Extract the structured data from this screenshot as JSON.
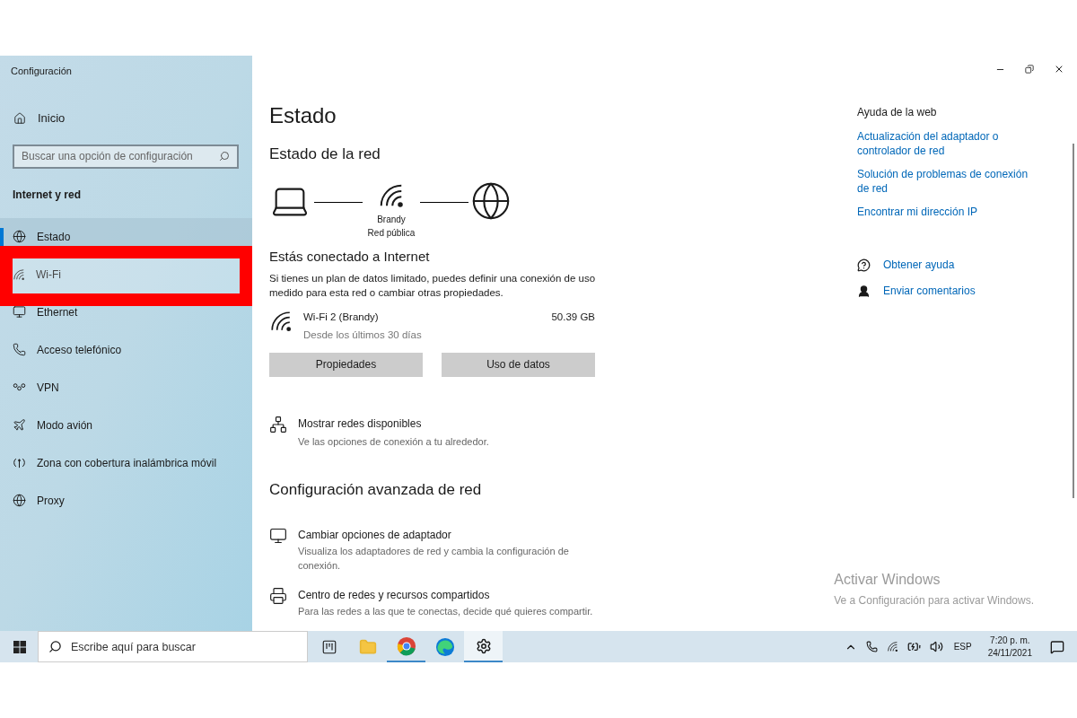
{
  "window": {
    "title": "Configuración"
  },
  "sidebar": {
    "home": "Inicio",
    "search": {
      "placeholder": "Buscar una opción de configuración"
    },
    "section": "Internet y red",
    "items": [
      {
        "label": "Estado",
        "selected": true,
        "highlighted": false
      },
      {
        "label": "Wi-Fi",
        "selected": false,
        "highlighted": true
      },
      {
        "label": "Ethernet",
        "selected": false,
        "highlighted": false
      },
      {
        "label": "Acceso telefónico",
        "selected": false,
        "highlighted": false
      },
      {
        "label": "VPN",
        "selected": false,
        "highlighted": false
      },
      {
        "label": "Modo avión",
        "selected": false,
        "highlighted": false
      },
      {
        "label": "Zona con cobertura inalámbrica móvil",
        "selected": false,
        "highlighted": false
      },
      {
        "label": "Proxy",
        "selected": false,
        "highlighted": false
      }
    ]
  },
  "main": {
    "title": "Estado",
    "network_heading": "Estado de la red",
    "network_name": "Brandy",
    "network_type": "Red pública",
    "connected_title": "Estás conectado a Internet",
    "connected_text": "Si tienes un plan de datos limitado, puedes definir una conexión de uso medido para esta red o cambiar otras propiedades.",
    "connection": {
      "name": "Wi-Fi 2 (Brandy)",
      "period": "Desde los últimos 30 días",
      "usage": "50.39 GB"
    },
    "buttons": [
      "Propiedades",
      "Uso de datos"
    ],
    "show_networks": {
      "title": "Mostrar redes disponibles",
      "subtitle": "Ve las opciones de conexión a tu alrededor."
    },
    "advanced_heading": "Configuración avanzada de red",
    "advanced": [
      {
        "title": "Cambiar opciones de adaptador",
        "subtitle": "Visualiza los adaptadores de red y cambia la configuración de conexión."
      },
      {
        "title": "Centro de redes y recursos compartidos",
        "subtitle": "Para las redes a las que te conectas, decide qué quieres compartir."
      }
    ]
  },
  "help": {
    "heading": "Ayuda de la web",
    "links": [
      "Actualización del adaptador o controlador de red",
      "Solución de problemas de conexión de red",
      "Encontrar mi dirección IP"
    ],
    "actions": [
      "Obtener ayuda",
      "Enviar comentarios"
    ]
  },
  "activation": {
    "title": "Activar Windows",
    "text": "Ve a Configuración para activar Windows."
  },
  "taskbar": {
    "search": {
      "placeholder": "Escribe aquí para buscar"
    },
    "apps": [
      {
        "running": false,
        "active": false
      },
      {
        "running": false,
        "active": false
      },
      {
        "running": true,
        "active": false
      },
      {
        "running": false,
        "active": false
      },
      {
        "running": true,
        "active": true
      }
    ],
    "language": "ESP",
    "time": "7:20 p. m.",
    "date": "24/11/2021"
  }
}
